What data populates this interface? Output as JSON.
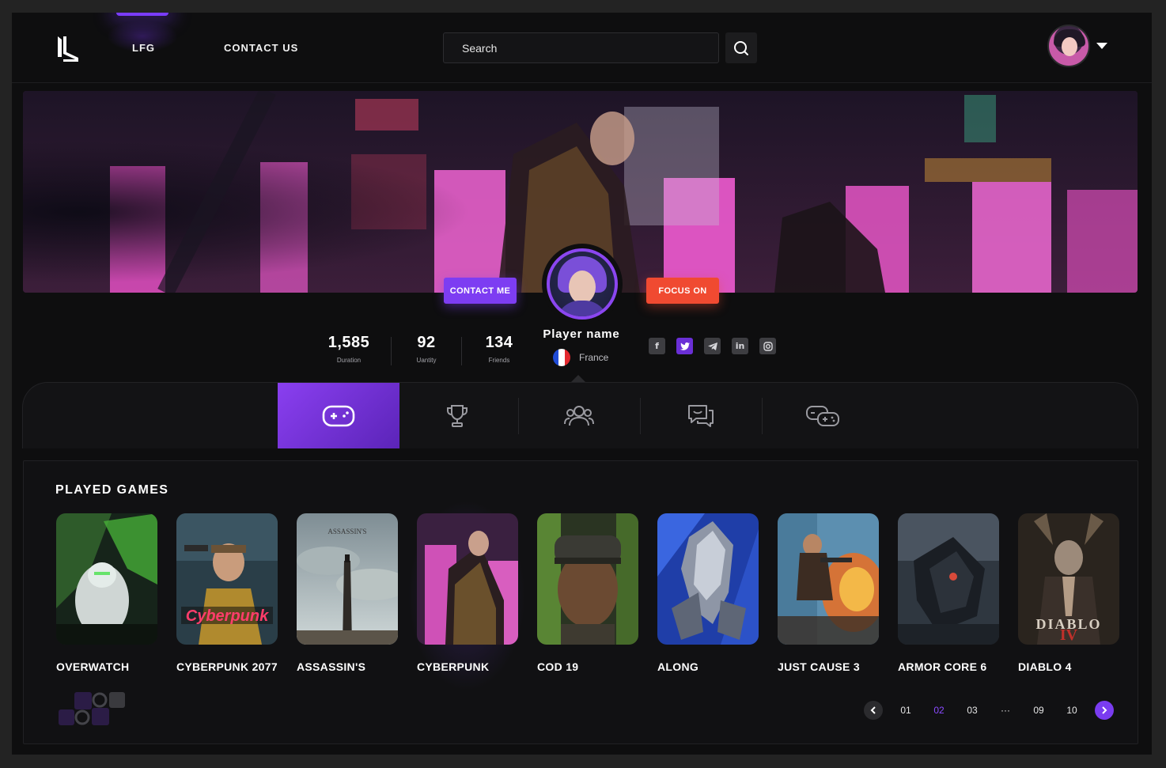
{
  "header": {
    "nav": [
      {
        "label": "LFG",
        "active": true
      },
      {
        "label": "CONTACT US",
        "active": false
      }
    ],
    "search": {
      "placeholder": "Search",
      "value": ""
    },
    "icons": {
      "logo": "brand-logo",
      "search": "search-icon",
      "avatar": "user-avatar",
      "menu": "caret-down-icon"
    }
  },
  "profile": {
    "contact_button": "CONTACT ME",
    "focus_button": "FOCUS ON",
    "player_name": "Player name",
    "country": "France",
    "stats": [
      {
        "value": "1,585",
        "label": "Duration"
      },
      {
        "value": "92",
        "label": "Uantity"
      },
      {
        "value": "134",
        "label": "Friends"
      }
    ],
    "socials": [
      "facebook-icon",
      "twitter-icon",
      "telegram-icon",
      "linkedin-icon",
      "instagram-icon"
    ],
    "active_social": "twitter-icon"
  },
  "tabs": [
    "gamepad-icon",
    "trophy-icon",
    "friends-icon",
    "chat-icon",
    "controllers-icon"
  ],
  "active_tab": "gamepad-icon",
  "played_games": {
    "title": "PLAYED GAMES",
    "games": [
      {
        "title": "OVERWATCH"
      },
      {
        "title": "CYBERPUNK 2077"
      },
      {
        "title": "ASSASSIN'S"
      },
      {
        "title": "CYBERPUNK"
      },
      {
        "title": "COD 19"
      },
      {
        "title": "ALONG"
      },
      {
        "title": "JUST CAUSE 3"
      },
      {
        "title": "ARMOR CORE 6"
      },
      {
        "title": "DIABLO 4"
      }
    ]
  },
  "pagination": {
    "pages": [
      "01",
      "02",
      "03",
      "···",
      "09",
      "10"
    ],
    "current": "02"
  },
  "colors": {
    "accent": "#7a3cf0",
    "focus": "#f04a31",
    "background": "#0e0e0f"
  }
}
